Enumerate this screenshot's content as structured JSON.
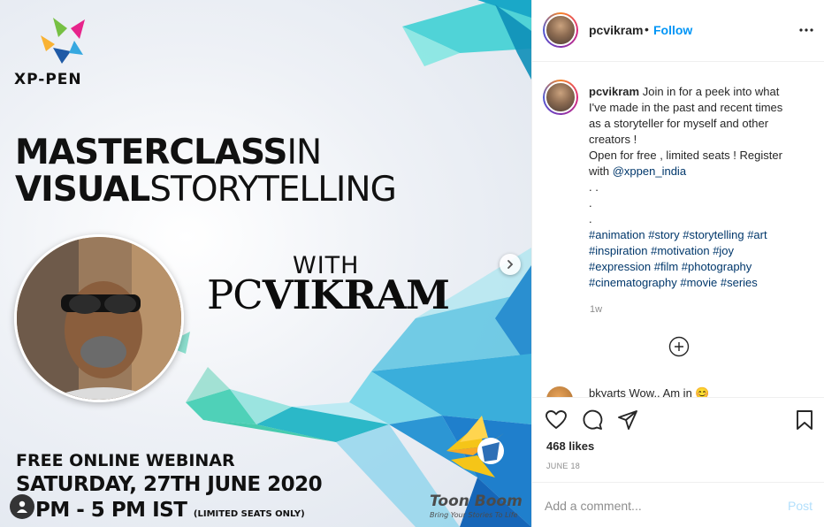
{
  "post_image": {
    "brand": "XP-PEN",
    "headline_line1_bold": "MASTERCLASS",
    "headline_line1_light": "IN",
    "headline_line2_bold": "VISUAL",
    "headline_line2_light": "STORYTELLING",
    "with_label": "WITH",
    "presenter_pc": "PC",
    "presenter_vikram": "VIKRAM",
    "webinar_label": "FREE ONLINE WEBINAR",
    "date_label": "SATURDAY, 27TH JUNE 2020",
    "time_label": "PM - 5 PM IST",
    "limited_label": "(LIMITED SEATS ONLY)",
    "sponsor": "Toon Boom",
    "sponsor_tagline": "Bring Your Stories To Life"
  },
  "header": {
    "username": "pcvikram",
    "separator": "•",
    "follow_label": "Follow"
  },
  "caption": {
    "username": "pcvikram",
    "line1": "Join in for a peek into what",
    "line2": "I've made in the past and recent times",
    "line3": "as a storyteller for myself and other",
    "line4": "creators !",
    "line5": "Open for free , limited seats ! Register",
    "line6_prefix": "with ",
    "mention": "@xppen_india",
    "dot1": ". .",
    "dot2": ".",
    "dot3": ".",
    "tags_line1": "#animation #story #storytelling #art",
    "tags_line2": "#inspiration #motivation #joy",
    "tags_line3": "#expression #film #photography",
    "tags_line4": "#cinematography #movie #series",
    "posted_ago": "1w"
  },
  "comment_preview": {
    "text": "bkyarts Wow.. Am in 😊"
  },
  "actions": {
    "likes": "468 likes",
    "date": "JUNE 18"
  },
  "comment_box": {
    "placeholder": "Add a comment...",
    "post_label": "Post"
  },
  "colors": {
    "link_blue": "#0095f6",
    "hashtag": "#00376b",
    "muted": "#8e8e8e"
  },
  "icons": [
    "heart-icon",
    "comment-icon",
    "share-icon",
    "bookmark-icon",
    "more-icon",
    "plus-circle-icon",
    "chevron-right-icon",
    "user-tag-icon"
  ]
}
